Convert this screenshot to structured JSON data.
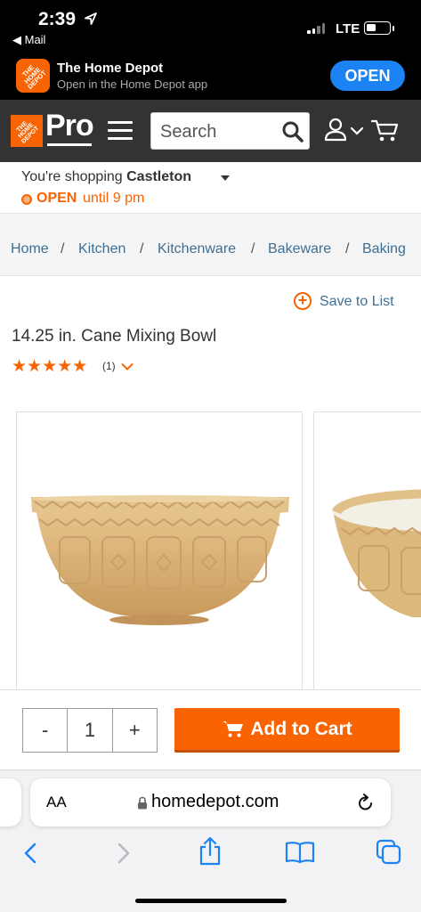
{
  "status_bar": {
    "time": "2:39",
    "back_app": "◀ Mail",
    "network": "LTE"
  },
  "app_banner": {
    "logo_text": "THE HOME DEPOT",
    "app_name": "The Home Depot",
    "subtitle": "Open in the Home Depot app",
    "open_button": "OPEN"
  },
  "header": {
    "logo_text": "THE HOME DEPOT",
    "pro_label": "Pro",
    "search_placeholder": "Search"
  },
  "store": {
    "prefix": "You're shopping",
    "name": "Castleton",
    "status": "OPEN",
    "hours": "until 9 pm"
  },
  "breadcrumb": [
    "Home",
    "Kitchen",
    "Kitchenware",
    "Bakeware",
    "Baking"
  ],
  "product": {
    "save_label": "Save to List",
    "title": "14.25 in. Cane Mixing Bowl",
    "rating": 5,
    "stars": "★★★★★",
    "review_count": "(1)"
  },
  "buy": {
    "minus": "-",
    "quantity": "1",
    "plus": "+",
    "add_to_cart": "Add to Cart"
  },
  "safari": {
    "aa_label": "AA",
    "url": "homedepot.com"
  },
  "colors": {
    "brand_orange": "#f96302",
    "link_blue": "#3d6f94",
    "ios_blue": "#1c83f5",
    "header_dark": "#333333"
  }
}
